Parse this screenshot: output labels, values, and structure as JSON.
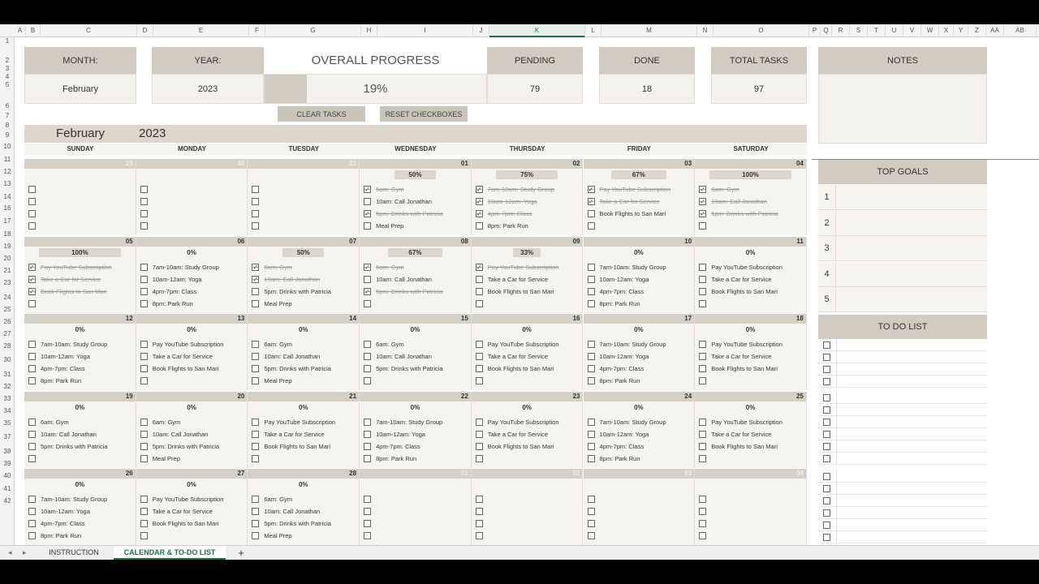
{
  "columns": [
    "A",
    "B",
    "C",
    "D",
    "E",
    "F",
    "G",
    "H",
    "I",
    "J",
    "K",
    "L",
    "M",
    "N",
    "O",
    "P",
    "Q",
    "R",
    "S",
    "T",
    "U",
    "V",
    "W",
    "X",
    "Y",
    "Z",
    "AA",
    "AB"
  ],
  "active_column": "K",
  "rows": [
    "1",
    "2",
    "3",
    "4",
    "5",
    "6",
    "7",
    "8",
    "9",
    "10",
    "11",
    "12",
    "13",
    "14",
    "16",
    "17",
    "18",
    "19",
    "20",
    "21",
    "23",
    "24",
    "25",
    "26",
    "27",
    "28",
    "30",
    "31",
    "32",
    "33",
    "34",
    "35",
    "37",
    "38",
    "39",
    "40",
    "41",
    "42"
  ],
  "header": {
    "month_label": "MONTH:",
    "month_value": "February",
    "year_label": "YEAR:",
    "year_value": "2023",
    "overall_progress_label": "OVERALL PROGRESS",
    "overall_progress_value": "19%",
    "overall_progress_fraction": 0.19,
    "pending_label": "PENDING",
    "pending_value": "79",
    "done_label": "DONE",
    "done_value": "18",
    "total_label": "TOTAL TASKS",
    "total_value": "97",
    "notes_label": "NOTES"
  },
  "buttons": {
    "clear_tasks": "CLEAR TASKS",
    "reset_checkboxes": "RESET CHECKBOXES"
  },
  "calendar": {
    "month": "February",
    "year": "2023",
    "weekdays": [
      "SUNDAY",
      "MONDAY",
      "TUESDAY",
      "WEDNESDAY",
      "THURSDAY",
      "FRIDAY",
      "SATURDAY"
    ],
    "weeks": [
      [
        {
          "day": "29",
          "other": true,
          "pct": "",
          "frac": 0,
          "tasks": [
            {
              "t": "",
              "d": false
            },
            {
              "t": "",
              "d": false
            },
            {
              "t": "",
              "d": false
            },
            {
              "t": "",
              "d": false
            }
          ]
        },
        {
          "day": "30",
          "other": true,
          "pct": "",
          "frac": 0,
          "tasks": [
            {
              "t": "",
              "d": false
            },
            {
              "t": "",
              "d": false
            },
            {
              "t": "",
              "d": false
            },
            {
              "t": "",
              "d": false
            }
          ]
        },
        {
          "day": "31",
          "other": true,
          "pct": "",
          "frac": 0,
          "tasks": [
            {
              "t": "",
              "d": false
            },
            {
              "t": "",
              "d": false
            },
            {
              "t": "",
              "d": false
            },
            {
              "t": "",
              "d": false
            }
          ]
        },
        {
          "day": "01",
          "other": false,
          "pct": "50%",
          "frac": 0.5,
          "tasks": [
            {
              "t": "6am: Gym",
              "d": true
            },
            {
              "t": "10am: Call Jonathan",
              "d": false
            },
            {
              "t": "5pm: Drinks with Patricia",
              "d": true
            },
            {
              "t": "Meal Prep",
              "d": false
            }
          ]
        },
        {
          "day": "02",
          "other": false,
          "pct": "75%",
          "frac": 0.75,
          "tasks": [
            {
              "t": "7am-10am: Study Group",
              "d": true
            },
            {
              "t": "10am-12am: Yoga",
              "d": true
            },
            {
              "t": "4pm-7pm: Class",
              "d": true
            },
            {
              "t": "8pm: Park Run",
              "d": false
            }
          ]
        },
        {
          "day": "03",
          "other": false,
          "pct": "67%",
          "frac": 0.67,
          "tasks": [
            {
              "t": "Pay YouTube Subscription",
              "d": true
            },
            {
              "t": "Take a Car for Service",
              "d": true
            },
            {
              "t": "Book Flights to San Mari",
              "d": false
            },
            {
              "t": "",
              "d": false
            }
          ]
        },
        {
          "day": "04",
          "other": false,
          "pct": "100%",
          "frac": 1,
          "tasks": [
            {
              "t": "6am: Gym",
              "d": true
            },
            {
              "t": "10am: Call Jonathan",
              "d": true
            },
            {
              "t": "5pm: Drinks with Patricia",
              "d": true
            },
            {
              "t": "",
              "d": false
            }
          ]
        }
      ],
      [
        {
          "day": "05",
          "other": false,
          "pct": "100%",
          "frac": 1,
          "tasks": [
            {
              "t": "Pay YouTube Subscription",
              "d": true
            },
            {
              "t": "Take a Car for Service",
              "d": true
            },
            {
              "t": "Book Flights to San Mari",
              "d": true
            },
            {
              "t": "",
              "d": false
            }
          ]
        },
        {
          "day": "06",
          "other": false,
          "pct": "0%",
          "frac": 0,
          "tasks": [
            {
              "t": "7am-10am: Study Group",
              "d": false
            },
            {
              "t": "10am-12am: Yoga",
              "d": false
            },
            {
              "t": "4pm-7pm: Class",
              "d": false
            },
            {
              "t": "8pm: Park Run",
              "d": false
            }
          ]
        },
        {
          "day": "07",
          "other": false,
          "pct": "50%",
          "frac": 0.5,
          "tasks": [
            {
              "t": "6am: Gym",
              "d": true
            },
            {
              "t": "10am: Call Jonathan",
              "d": true
            },
            {
              "t": "5pm: Drinks with Patricia",
              "d": false
            },
            {
              "t": "Meal Prep",
              "d": false
            }
          ]
        },
        {
          "day": "08",
          "other": false,
          "pct": "67%",
          "frac": 0.67,
          "tasks": [
            {
              "t": "6am: Gym",
              "d": true
            },
            {
              "t": "10am: Call Jonathan",
              "d": false
            },
            {
              "t": "5pm: Drinks with Patricia",
              "d": true
            },
            {
              "t": "",
              "d": false
            }
          ]
        },
        {
          "day": "09",
          "other": false,
          "pct": "33%",
          "frac": 0.33,
          "tasks": [
            {
              "t": "Pay YouTube Subscription",
              "d": true
            },
            {
              "t": "Take a Car for Service",
              "d": false
            },
            {
              "t": "Book Flights to San Mari",
              "d": false
            },
            {
              "t": "",
              "d": false
            }
          ]
        },
        {
          "day": "10",
          "other": false,
          "pct": "0%",
          "frac": 0,
          "tasks": [
            {
              "t": "7am-10am: Study Group",
              "d": false
            },
            {
              "t": "10am-12am: Yoga",
              "d": false
            },
            {
              "t": "4pm-7pm: Class",
              "d": false
            },
            {
              "t": "8pm: Park Run",
              "d": false
            }
          ]
        },
        {
          "day": "11",
          "other": false,
          "pct": "0%",
          "frac": 0,
          "tasks": [
            {
              "t": "Pay YouTube Subscription",
              "d": false
            },
            {
              "t": "Take a Car for Service",
              "d": false
            },
            {
              "t": "Book Flights to San Mari",
              "d": false
            },
            {
              "t": "",
              "d": false
            }
          ]
        }
      ],
      [
        {
          "day": "12",
          "other": false,
          "pct": "0%",
          "frac": 0,
          "tasks": [
            {
              "t": "7am-10am: Study Group",
              "d": false
            },
            {
              "t": "10am-12am: Yoga",
              "d": false
            },
            {
              "t": "4pm-7pm: Class",
              "d": false
            },
            {
              "t": "8pm: Park Run",
              "d": false
            }
          ]
        },
        {
          "day": "13",
          "other": false,
          "pct": "0%",
          "frac": 0,
          "tasks": [
            {
              "t": "Pay YouTube Subscription",
              "d": false
            },
            {
              "t": "Take a Car for Service",
              "d": false
            },
            {
              "t": "Book Flights to San Mari",
              "d": false
            },
            {
              "t": "",
              "d": false
            }
          ]
        },
        {
          "day": "14",
          "other": false,
          "pct": "0%",
          "frac": 0,
          "tasks": [
            {
              "t": "6am: Gym",
              "d": false
            },
            {
              "t": "10am: Call Jonathan",
              "d": false
            },
            {
              "t": "5pm: Drinks with Patricia",
              "d": false
            },
            {
              "t": "Meal Prep",
              "d": false
            }
          ]
        },
        {
          "day": "15",
          "other": false,
          "pct": "0%",
          "frac": 0,
          "tasks": [
            {
              "t": "6am: Gym",
              "d": false
            },
            {
              "t": "10am: Call Jonathan",
              "d": false
            },
            {
              "t": "5pm: Drinks with Patricia",
              "d": false
            },
            {
              "t": "",
              "d": false
            }
          ]
        },
        {
          "day": "16",
          "other": false,
          "pct": "0%",
          "frac": 0,
          "tasks": [
            {
              "t": "Pay YouTube Subscription",
              "d": false
            },
            {
              "t": "Take a Car for Service",
              "d": false
            },
            {
              "t": "Book Flights to San Mari",
              "d": false
            },
            {
              "t": "",
              "d": false
            }
          ]
        },
        {
          "day": "17",
          "other": false,
          "pct": "0%",
          "frac": 0,
          "tasks": [
            {
              "t": "7am-10am: Study Group",
              "d": false
            },
            {
              "t": "10am-12am: Yoga",
              "d": false
            },
            {
              "t": "4pm-7pm: Class",
              "d": false
            },
            {
              "t": "8pm: Park Run",
              "d": false
            }
          ]
        },
        {
          "day": "18",
          "other": false,
          "pct": "0%",
          "frac": 0,
          "tasks": [
            {
              "t": "Pay YouTube Subscription",
              "d": false
            },
            {
              "t": "Take a Car for Service",
              "d": false
            },
            {
              "t": "Book Flights to San Mari",
              "d": false
            },
            {
              "t": "",
              "d": false
            }
          ]
        }
      ],
      [
        {
          "day": "19",
          "other": false,
          "pct": "0%",
          "frac": 0,
          "tasks": [
            {
              "t": "6am: Gym",
              "d": false
            },
            {
              "t": "10am: Call Jonathan",
              "d": false
            },
            {
              "t": "5pm: Drinks with Patricia",
              "d": false
            },
            {
              "t": "",
              "d": false
            }
          ]
        },
        {
          "day": "20",
          "other": false,
          "pct": "0%",
          "frac": 0,
          "tasks": [
            {
              "t": "6am: Gym",
              "d": false
            },
            {
              "t": "10am: Call Jonathan",
              "d": false
            },
            {
              "t": "5pm: Drinks with Patricia",
              "d": false
            },
            {
              "t": "Meal Prep",
              "d": false
            }
          ]
        },
        {
          "day": "21",
          "other": false,
          "pct": "0%",
          "frac": 0,
          "tasks": [
            {
              "t": "Pay YouTube Subscription",
              "d": false
            },
            {
              "t": "Take a Car for Service",
              "d": false
            },
            {
              "t": "Book Flights to San Mari",
              "d": false
            },
            {
              "t": "",
              "d": false
            }
          ]
        },
        {
          "day": "22",
          "other": false,
          "pct": "0%",
          "frac": 0,
          "tasks": [
            {
              "t": "7am-10am: Study Group",
              "d": false
            },
            {
              "t": "10am-12am: Yoga",
              "d": false
            },
            {
              "t": "4pm-7pm: Class",
              "d": false
            },
            {
              "t": "8pm: Park Run",
              "d": false
            }
          ]
        },
        {
          "day": "23",
          "other": false,
          "pct": "0%",
          "frac": 0,
          "tasks": [
            {
              "t": "Pay YouTube Subscription",
              "d": false
            },
            {
              "t": "Take a Car for Service",
              "d": false
            },
            {
              "t": "Book Flights to San Mari",
              "d": false
            },
            {
              "t": "",
              "d": false
            }
          ]
        },
        {
          "day": "24",
          "other": false,
          "pct": "0%",
          "frac": 0,
          "tasks": [
            {
              "t": "7am-10am: Study Group",
              "d": false
            },
            {
              "t": "10am-12am: Yoga",
              "d": false
            },
            {
              "t": "4pm-7pm: Class",
              "d": false
            },
            {
              "t": "8pm: Park Run",
              "d": false
            }
          ]
        },
        {
          "day": "25",
          "other": false,
          "pct": "0%",
          "frac": 0,
          "tasks": [
            {
              "t": "Pay YouTube Subscription",
              "d": false
            },
            {
              "t": "Take a Car for Service",
              "d": false
            },
            {
              "t": "Book Flights to San Mari",
              "d": false
            },
            {
              "t": "",
              "d": false
            }
          ]
        }
      ],
      [
        {
          "day": "26",
          "other": false,
          "pct": "0%",
          "frac": 0,
          "tasks": [
            {
              "t": "7am-10am: Study Group",
              "d": false
            },
            {
              "t": "10am-12am: Yoga",
              "d": false
            },
            {
              "t": "4pm-7pm: Class",
              "d": false
            },
            {
              "t": "8pm: Park Run",
              "d": false
            }
          ]
        },
        {
          "day": "27",
          "other": false,
          "pct": "0%",
          "frac": 0,
          "tasks": [
            {
              "t": "Pay YouTube Subscription",
              "d": false
            },
            {
              "t": "Take a Car for Service",
              "d": false
            },
            {
              "t": "Book Flights to San Mari",
              "d": false
            },
            {
              "t": "",
              "d": false
            }
          ]
        },
        {
          "day": "28",
          "other": false,
          "pct": "0%",
          "frac": 0,
          "tasks": [
            {
              "t": "6am: Gym",
              "d": false
            },
            {
              "t": "10am: Call Jonathan",
              "d": false
            },
            {
              "t": "5pm: Drinks with Patricia",
              "d": false
            },
            {
              "t": "Meal Prep",
              "d": false
            }
          ]
        },
        {
          "day": "01",
          "other": true,
          "pct": "",
          "frac": 0,
          "tasks": [
            {
              "t": "",
              "d": false
            },
            {
              "t": "",
              "d": false
            },
            {
              "t": "",
              "d": false
            },
            {
              "t": "",
              "d": false
            }
          ]
        },
        {
          "day": "02",
          "other": true,
          "pct": "",
          "frac": 0,
          "tasks": [
            {
              "t": "",
              "d": false
            },
            {
              "t": "",
              "d": false
            },
            {
              "t": "",
              "d": false
            },
            {
              "t": "",
              "d": false
            }
          ]
        },
        {
          "day": "03",
          "other": true,
          "pct": "",
          "frac": 0,
          "tasks": [
            {
              "t": "",
              "d": false
            },
            {
              "t": "",
              "d": false
            },
            {
              "t": "",
              "d": false
            },
            {
              "t": "",
              "d": false
            }
          ]
        },
        {
          "day": "04",
          "other": true,
          "pct": "",
          "frac": 0,
          "tasks": [
            {
              "t": "",
              "d": false
            },
            {
              "t": "",
              "d": false
            },
            {
              "t": "",
              "d": false
            },
            {
              "t": "",
              "d": false
            }
          ]
        }
      ]
    ]
  },
  "top_goals": {
    "title": "TOP GOALS",
    "numbers": [
      "1",
      "2",
      "3",
      "4",
      "5"
    ]
  },
  "todo_list": {
    "title": "TO DO LIST",
    "rows": 16
  },
  "tabs": {
    "instruction": "INSTRUCTION",
    "calendar": "CALENDAR & TO-DO LIST",
    "add": "+"
  },
  "colors": {
    "header_bg": "#d2cbc1",
    "cell_bg": "#f6f4ef",
    "accent_green": "#1e7145"
  }
}
